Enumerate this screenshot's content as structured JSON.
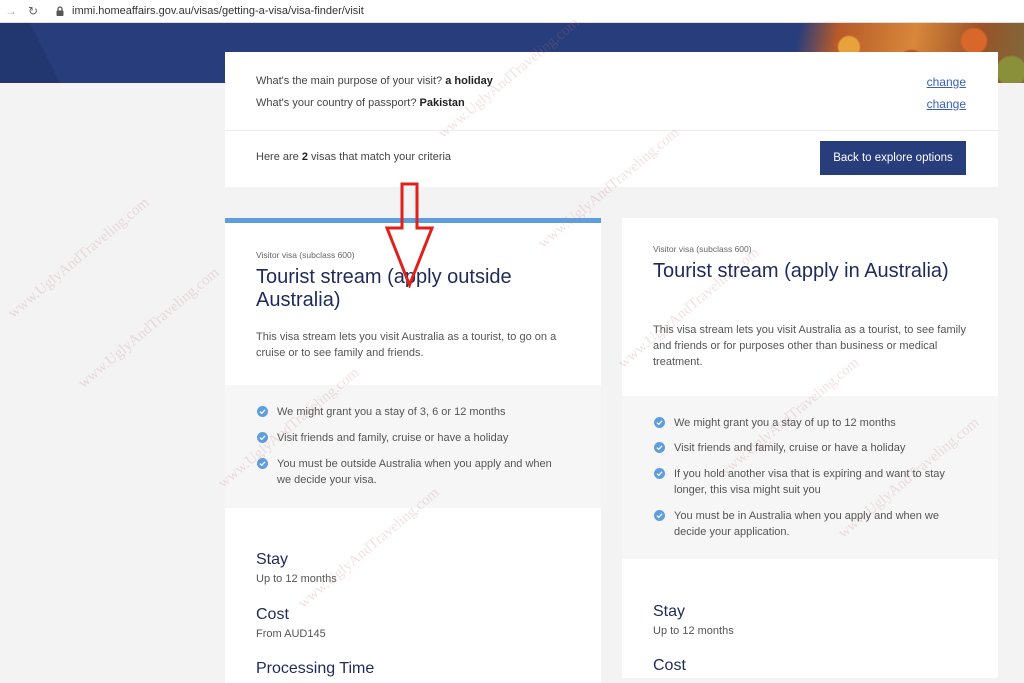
{
  "browser": {
    "url": "immi.homeaffairs.gov.au/visas/getting-a-visa/visa-finder/visit"
  },
  "summary": {
    "purpose_question": "What's the main purpose of your visit?",
    "purpose_answer": "a holiday",
    "passport_question": "What's your country of passport?",
    "passport_answer": "Pakistan",
    "change_label_1": "change",
    "change_label_2": "change",
    "match_prefix": "Here are",
    "match_count": "2",
    "match_suffix": "visas that match your criteria",
    "back_button": "Back to explore options"
  },
  "cards": [
    {
      "subclass": "Visitor visa (subclass 600)",
      "title": "Tourist stream (apply outside Australia)",
      "description": "This visa stream lets you visit Australia as a tourist, to go on a cruise or to see family and friends.",
      "features": [
        "We might grant you a stay of 3, 6 or 12 months",
        "Visit friends and family, cruise or have a holiday",
        "You must be outside Australia when you apply and when we decide your visa."
      ],
      "stay_label": "Stay",
      "stay_value": "Up to 12 months",
      "cost_label": "Cost",
      "cost_value": "From AUD145",
      "processing_label": "Processing Time"
    },
    {
      "subclass": "Visitor visa (subclass 600)",
      "title": "Tourist stream (apply in Australia)",
      "description": "This visa stream lets you visit Australia as a tourist, to see family and friends or for purposes other than business or medical treatment.",
      "features": [
        "We might grant you a stay of up to 12 months",
        "Visit friends and family, cruise or have a holiday",
        "If you hold another visa that is expiring and want to stay longer, this visa might suit you",
        "You must be in Australia when you apply and when we decide your application."
      ],
      "stay_label": "Stay",
      "stay_value": "Up to 12 months",
      "cost_label": "Cost"
    }
  ],
  "watermark": "www.UglyAndTraveling.com",
  "colors": {
    "brand_navy": "#283d7c",
    "accent_blue": "#5f9ede",
    "link_blue": "#3b5fc0",
    "arrow_red": "#e0201b"
  },
  "icons": {
    "back": "arrow-left-icon",
    "reload": "reload-icon",
    "lock": "lock-icon",
    "check": "check-circle-icon",
    "annotation": "red-down-arrow-icon"
  }
}
